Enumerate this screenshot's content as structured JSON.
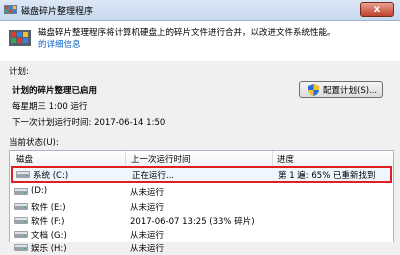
{
  "window": {
    "title": "磁盘碎片整理程序",
    "close": "x"
  },
  "header": {
    "description_line1": "磁盘碎片整理程序将计算机硬盘上的碎片文件进行合并，以改进文件系统性能。",
    "description_link": "获取有关磁盘碎片整理程序的详细信息。",
    "help_link": "获取有关磁盘碎片整理程序的详细信息。"
  },
  "schedule": {
    "section_label": "计划:",
    "status_title": "计划的碎片整理已启用",
    "frequency": "每星期三 1:00 运行",
    "next_run": "下一次计划运行时间: 2017-06-14 1:50",
    "config_button": "配置计划(S)..."
  },
  "current_status": {
    "section_label": "当前状态(U):",
    "columns": [
      "磁盘",
      "上一次运行时间",
      "进度"
    ],
    "rows": [
      {
        "disk": "系统 (C:)",
        "last_run": "正在运行...",
        "progress": "第 1 遍: 65% 已重新找到",
        "selected": true
      },
      {
        "disk": "(D:)",
        "last_run": "从未运行",
        "progress": ""
      },
      {
        "disk": "软件 (E:)",
        "last_run": "从未运行",
        "progress": ""
      },
      {
        "disk": "软件 (F:)",
        "last_run": "2017-06-07 13:25 (33% 碎片)",
        "progress": ""
      },
      {
        "disk": "文档 (G:)",
        "last_run": "从未运行",
        "progress": ""
      },
      {
        "disk": "娱乐 (H:)",
        "last_run": "从未运行",
        "progress": ""
      }
    ]
  },
  "icons": {
    "app": "defrag-icon",
    "shield": "shield-icon",
    "disk": "hard-disk-icon"
  }
}
